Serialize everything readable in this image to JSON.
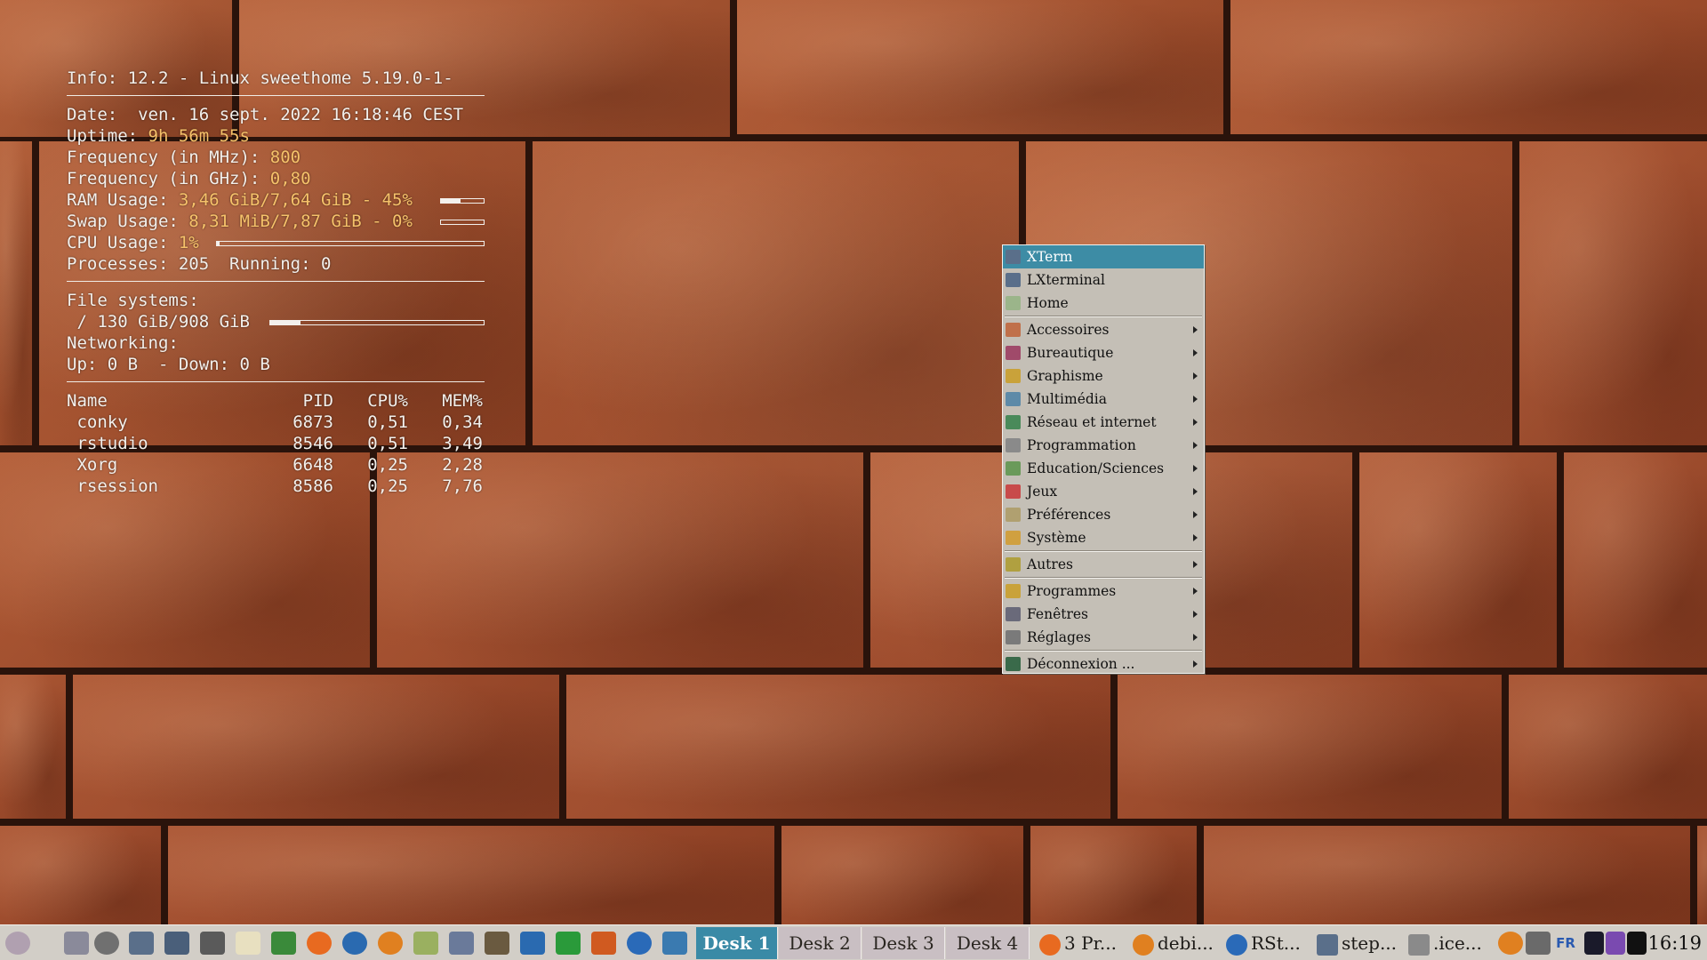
{
  "conky": {
    "info": "Info: 12.2 - Linux sweethome 5.19.0-1-",
    "date": "Date:  ven. 16 sept. 2022 16:18:46 CEST",
    "uptime_label": "Uptime: ",
    "uptime": "9h 56m 55s",
    "freq_mhz_label": "Frequency (in MHz): ",
    "freq_mhz": "800",
    "freq_ghz_label": "Frequency (in GHz): ",
    "freq_ghz": "0,80",
    "ram_label": "RAM Usage: ",
    "ram": "3,46 GiB/7,64 GiB - 45%",
    "ram_fraction": 0.45,
    "swap_label": "Swap Usage: ",
    "swap": "8,31 MiB/7,87 GiB - 0%",
    "swap_fraction": 0.0,
    "cpu_label": "CPU Usage: ",
    "cpu": "1%",
    "cpu_fraction": 0.01,
    "processes": "Processes: 205  Running: 0",
    "fs_title": "File systems:",
    "fs_root": " / 130 GiB/908 GiB",
    "fs_fraction": 0.143,
    "net_title": "Networking:",
    "net": "Up: 0 B  - Down: 0 B",
    "proc_headers": [
      "Name",
      "PID",
      "CPU%",
      "MEM%"
    ],
    "procs": [
      {
        "name": " conky",
        "pid": "6873",
        "cpu": "0,51",
        "mem": "0,34"
      },
      {
        "name": " rstudio",
        "pid": "8546",
        "cpu": "0,51",
        "mem": "3,49"
      },
      {
        "name": " Xorg",
        "pid": "6648",
        "cpu": "0,25",
        "mem": "2,28"
      },
      {
        "name": " rsession",
        "pid": "8586",
        "cpu": "0,25",
        "mem": "7,76"
      }
    ]
  },
  "menu": {
    "items": [
      {
        "label": "XTerm",
        "icon": "terminal-icon",
        "color": "#5a6f8a",
        "submenu": false,
        "selected": true
      },
      {
        "label": "LXterminal",
        "icon": "terminal-icon",
        "color": "#5a6f8a",
        "submenu": false
      },
      {
        "label": "Home",
        "icon": "home-folder-icon",
        "color": "#9bb58a",
        "submenu": false
      },
      {
        "sep": true
      },
      {
        "label": "Accessoires",
        "icon": "accessories-icon",
        "color": "#c0704a",
        "submenu": true
      },
      {
        "label": "Bureautique",
        "icon": "office-icon",
        "color": "#a04a6a",
        "submenu": true
      },
      {
        "label": "Graphisme",
        "icon": "graphics-icon",
        "color": "#c9a23a",
        "submenu": true
      },
      {
        "label": "Multimédia",
        "icon": "multimedia-icon",
        "color": "#5e8aa8",
        "submenu": true
      },
      {
        "label": "Réseau et internet",
        "icon": "globe-icon",
        "color": "#4a8a5a",
        "submenu": true
      },
      {
        "label": "Programmation",
        "icon": "programming-icon",
        "color": "#8a8a8a",
        "submenu": true
      },
      {
        "label": "Education/Sciences",
        "icon": "education-icon",
        "color": "#6a9a5a",
        "submenu": true
      },
      {
        "label": "Jeux",
        "icon": "games-icon",
        "color": "#c84a4a",
        "submenu": true
      },
      {
        "label": "Préférences",
        "icon": "preferences-icon",
        "color": "#b0a070",
        "submenu": true
      },
      {
        "label": "Système",
        "icon": "system-icon",
        "color": "#d0a040",
        "submenu": true
      },
      {
        "sep": true
      },
      {
        "label": "Autres",
        "icon": "others-icon",
        "color": "#b0a040",
        "submenu": true
      },
      {
        "sep": true
      },
      {
        "label": "Programmes",
        "icon": "programs-icon",
        "color": "#c9a23a",
        "submenu": true
      },
      {
        "label": "Fenêtres",
        "icon": "windows-icon",
        "color": "#6a6a7a",
        "submenu": true
      },
      {
        "label": "Réglages",
        "icon": "settings-icon",
        "color": "#7a7a7a",
        "submenu": true
      },
      {
        "sep": true
      },
      {
        "label": "Déconnexion ...",
        "icon": "logout-icon",
        "color": "#3a6a4a",
        "submenu": true
      }
    ]
  },
  "taskbar": {
    "launchers": [
      {
        "icon": "start-menu-icon",
        "color": "#b0a0b0"
      },
      {
        "icon": "show-desktop-icon",
        "color": "#d2cec7"
      },
      {
        "icon": "window-list-icon",
        "color": "#8a8a9a"
      },
      {
        "icon": "gear-icon",
        "color": "#707070"
      },
      {
        "icon": "terminal-icon",
        "color": "#5a6f8a"
      },
      {
        "icon": "terminal-icon",
        "color": "#4a5f7a"
      },
      {
        "icon": "calculator-icon",
        "color": "#5a5a5a"
      },
      {
        "icon": "text-editor-icon",
        "color": "#e8e0c0"
      },
      {
        "icon": "gvim-icon",
        "color": "#3a8a3a"
      },
      {
        "icon": "firefox-icon",
        "color": "#e86a20"
      },
      {
        "icon": "thunderbird-icon",
        "color": "#2a6ab0"
      },
      {
        "icon": "lifesaver-icon",
        "color": "#e08020"
      },
      {
        "icon": "notes-icon",
        "color": "#9ab060"
      },
      {
        "icon": "screenshot-icon",
        "color": "#6a7a9a"
      },
      {
        "icon": "gimp-icon",
        "color": "#6a5a40"
      },
      {
        "icon": "writer-icon",
        "color": "#2a6ab0"
      },
      {
        "icon": "calc-icon",
        "color": "#2a9a3a"
      },
      {
        "icon": "impress-icon",
        "color": "#d05a20"
      },
      {
        "icon": "r-icon",
        "color": "#2a6ab8"
      },
      {
        "icon": "python-icon",
        "color": "#3a7ab0"
      }
    ],
    "desks": [
      "Desk 1",
      "Desk 2",
      "Desk 3",
      "Desk 4"
    ],
    "active_desk": 0,
    "tasks": [
      {
        "label": "3 Pr...",
        "icon": "firefox-icon",
        "color": "#e86a20"
      },
      {
        "label": "debi...",
        "icon": "lifesaver-icon",
        "color": "#e08020"
      },
      {
        "label": "RSt...",
        "icon": "r-icon",
        "color": "#2a6ab8"
      },
      {
        "label": "step...",
        "icon": "terminal-icon",
        "color": "#5a6f8a"
      },
      {
        "label": ".ice...",
        "icon": "folder-icon",
        "color": "#8a8a8a"
      }
    ],
    "tray": [
      {
        "icon": "lifesaver-icon",
        "color": "#e08020"
      },
      {
        "icon": "volume-icon",
        "color": "#6a6a6a"
      },
      {
        "icon": "keyboard-layout-icon",
        "color": "#2a5ab0"
      },
      {
        "icon": "cpu-monitor-icon",
        "color": "#1a1a2a"
      },
      {
        "icon": "memory-monitor-icon",
        "color": "#7a4ab0"
      },
      {
        "icon": "network-monitor-icon",
        "color": "#111111"
      }
    ],
    "keyboard_layout": "FR",
    "clock": "16:19"
  }
}
